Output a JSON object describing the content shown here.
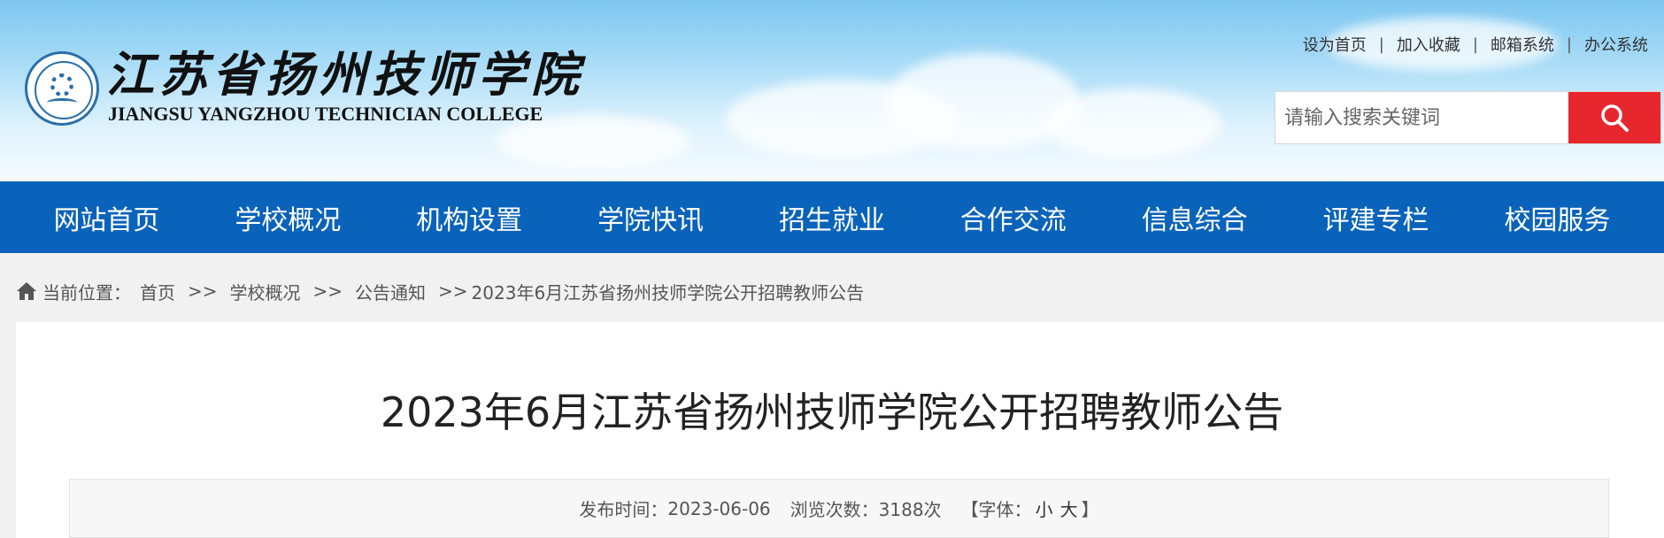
{
  "header": {
    "logo_cn": "江苏省扬州技师学院",
    "logo_en": "JIANGSU YANGZHOU TECHNICIAN COLLEGE",
    "top_links": [
      "设为首页",
      "加入收藏",
      "邮箱系统",
      "办公系统"
    ],
    "top_link_separator": "|",
    "search_placeholder": "请输入搜索关键词",
    "search_icon": "search-icon",
    "search_button_color": "#e8262e"
  },
  "nav": {
    "items": [
      "网站首页",
      "学校概况",
      "机构设置",
      "学院快讯",
      "招生就业",
      "合作交流",
      "信息综合",
      "评建专栏",
      "校园服务"
    ],
    "background": "#0a63ba"
  },
  "breadcrumb": {
    "icon": "home-icon",
    "prefix": "当前位置：",
    "items": [
      "首页",
      "学校概况",
      "公告通知",
      "2023年6月江苏省扬州技师学院公开招聘教师公告"
    ],
    "separator": ">>"
  },
  "article": {
    "title": "2023年6月江苏省扬州技师学院公开招聘教师公告",
    "publish_label": "发布时间：",
    "publish_date": "2023-06-06",
    "views_label": "浏览次数：",
    "views_value": "3188次",
    "font_label_open": "【字体：",
    "font_small": "小",
    "font_large": "大",
    "font_label_close": "】"
  }
}
